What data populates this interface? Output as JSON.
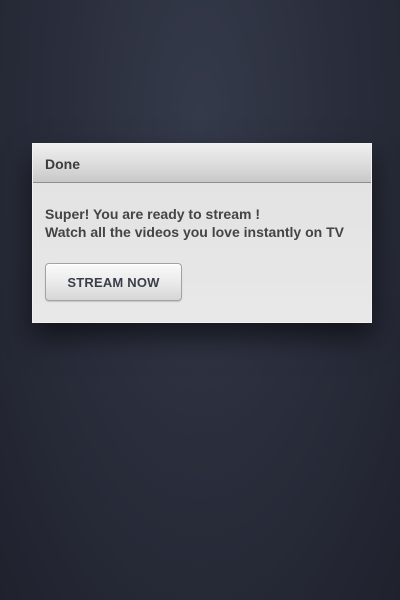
{
  "dialog": {
    "title": "Done",
    "message_lines": [
      "Super! You are ready to stream !",
      "Watch all the videos you love instantly on TV"
    ],
    "button_label": "STREAM NOW"
  },
  "colors": {
    "background": "#2b2f3d",
    "dialog_background": "#e6e6e6",
    "text": "#444444"
  }
}
